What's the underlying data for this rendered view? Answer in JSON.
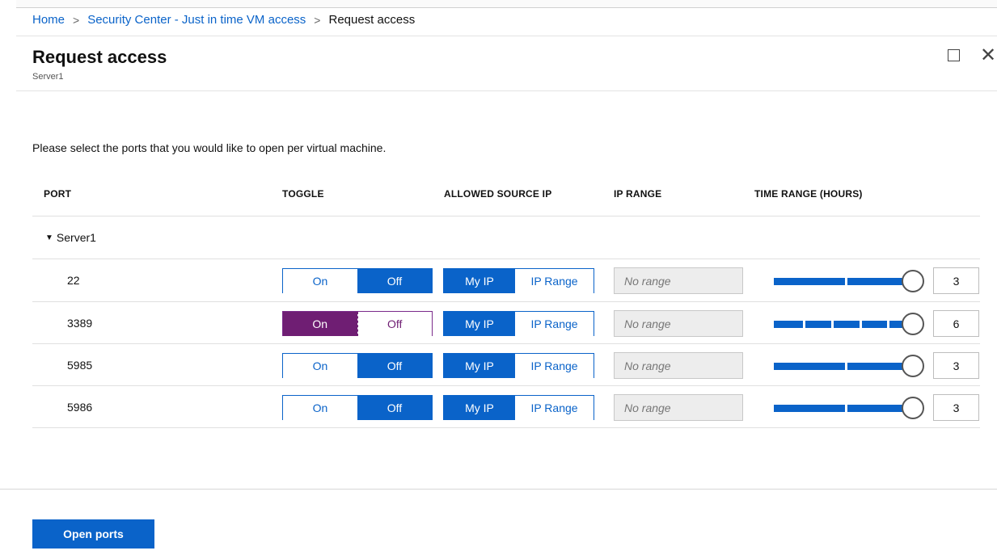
{
  "breadcrumb": {
    "home": "Home",
    "security_center": "Security Center - Just in time VM access",
    "current": "Request access",
    "separator": ">"
  },
  "header": {
    "title": "Request access",
    "subtitle": "Server1",
    "maximize_icon": "maximize-icon",
    "close_icon": "close-icon",
    "close_glyph": "✕"
  },
  "instructions": "Please select the ports that you would like to open per virtual machine.",
  "columns": {
    "port": "PORT",
    "toggle": "TOGGLE",
    "allowed_source_ip": "ALLOWED SOURCE IP",
    "ip_range": "IP RANGE",
    "time_range": "TIME RANGE (HOURS)"
  },
  "group": {
    "label": "Server1",
    "expand_icon": "caret-down-icon",
    "expand_glyph": "▼"
  },
  "rows": [
    {
      "port": "22",
      "toggle_on": "On",
      "toggle_off": "Off",
      "toggle_state": "off",
      "src_myip": "My IP",
      "src_iprange": "IP Range",
      "ip_range_placeholder": "No range",
      "hours": "3"
    },
    {
      "port": "3389",
      "toggle_on": "On",
      "toggle_off": "Off",
      "toggle_state": "on",
      "src_myip": "My IP",
      "src_iprange": "IP Range",
      "ip_range_placeholder": "No range",
      "hours": "6"
    },
    {
      "port": "5985",
      "toggle_on": "On",
      "toggle_off": "Off",
      "toggle_state": "off",
      "src_myip": "My IP",
      "src_iprange": "IP Range",
      "ip_range_placeholder": "No range",
      "hours": "3"
    },
    {
      "port": "5986",
      "toggle_on": "On",
      "toggle_off": "Off",
      "toggle_state": "off",
      "src_myip": "My IP",
      "src_iprange": "IP Range",
      "ip_range_placeholder": "No range",
      "hours": "3"
    }
  ],
  "footer": {
    "open_ports_label": "Open ports"
  },
  "colors": {
    "accent": "#0a63c9",
    "toggle_active": "#6f1e73"
  }
}
